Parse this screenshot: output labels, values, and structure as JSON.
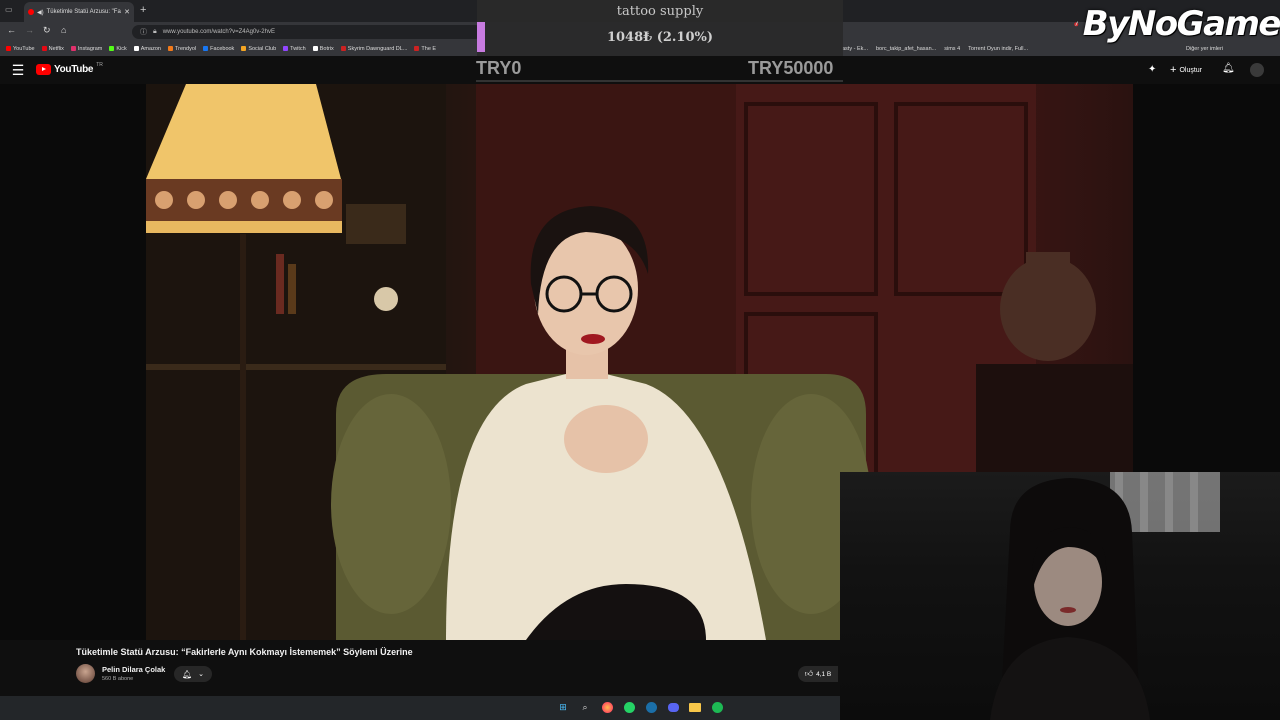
{
  "browser": {
    "tab_title": "Tüketimle Statü Arzusu: \"Fa",
    "url": "www.youtube.com/watch?v=Z4Ag0v-2hvE",
    "bookmarks": [
      {
        "label": "YouTube",
        "color": "#ff0000"
      },
      {
        "label": "Netflix",
        "color": "#e50914"
      },
      {
        "label": "Instagram",
        "color": "#e1306c"
      },
      {
        "label": "Kick",
        "color": "#53fc18"
      },
      {
        "label": "Amazon",
        "color": "#ffffff"
      },
      {
        "label": "Trendyol",
        "color": "#f27a1a"
      },
      {
        "label": "Facebook",
        "color": "#1877f2"
      },
      {
        "label": "Social Club",
        "color": "#f5a623"
      },
      {
        "label": "Twitch",
        "color": "#9146ff"
      },
      {
        "label": "Botrix",
        "color": "#ffffff"
      },
      {
        "label": "Skyrim Dawnguard DL...",
        "color": "#cc2222"
      },
      {
        "label": "The E",
        "color": "#cc2222"
      }
    ],
    "bookmarks_right": [
      "asty - Ek...",
      "borc_takip_afet_hasan...",
      "sims 4",
      "Torrent Oyun indir, Full..."
    ],
    "other_bookmarks": "Diğer yer imleri"
  },
  "donation_goal": {
    "title": "tattoo supply",
    "amount": "1048₺ (2.10%)",
    "progress_percent": 2.1,
    "start_label": "TRY0",
    "end_label": "TRY50000",
    "bar_color": "#c77be0"
  },
  "stream_logo": {
    "text": "ByNoGame"
  },
  "youtube": {
    "brand": "YouTube",
    "country": "TR",
    "create_label": "Oluştur",
    "video_title": "Tüketimle Statü Arzusu: “Fakirlerle Aynı Kokmayı İstememek” Söylemi Üzerine",
    "channel_name": "Pelin Dilara Çolak",
    "subscribers": "560 B abone",
    "likes": "4,1 B"
  },
  "taskbar": {
    "icons": [
      "windows-start",
      "search",
      "firefox",
      "whatsapp",
      "steam",
      "discord",
      "file-explorer",
      "spotify"
    ]
  }
}
